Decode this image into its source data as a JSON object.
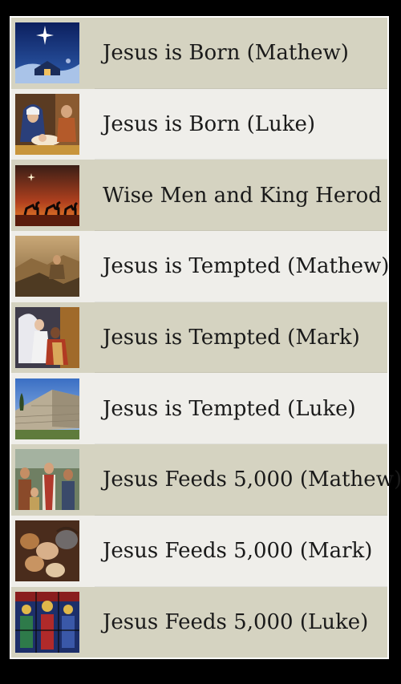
{
  "items": [
    {
      "label": "Jesus is Born (Mathew)",
      "thumbnail": "nativity-star-icon"
    },
    {
      "label": "Jesus is Born (Luke)",
      "thumbnail": "mary-and-baby-icon"
    },
    {
      "label": "Wise Men and King Herod",
      "thumbnail": "wise-men-camels-icon"
    },
    {
      "label": "Jesus is Tempted (Mathew)",
      "thumbnail": "wilderness-icon"
    },
    {
      "label": "Jesus is Tempted (Mark)",
      "thumbnail": "angel-comfort-icon"
    },
    {
      "label": "Jesus is Tempted (Luke)",
      "thumbnail": "temple-wall-icon"
    },
    {
      "label": "Jesus Feeds 5,000 (Mathew)",
      "thumbnail": "crowd-icon"
    },
    {
      "label": "Jesus Feeds 5,000 (Mark)",
      "thumbnail": "bread-loaves-icon"
    },
    {
      "label": "Jesus Feeds 5,000 (Luke)",
      "thumbnail": "stained-glass-icon"
    }
  ],
  "colors": {
    "row_dark": "#d5d3c1",
    "row_light": "#efeeea",
    "text": "#1a1a1a",
    "background": "#000000"
  }
}
